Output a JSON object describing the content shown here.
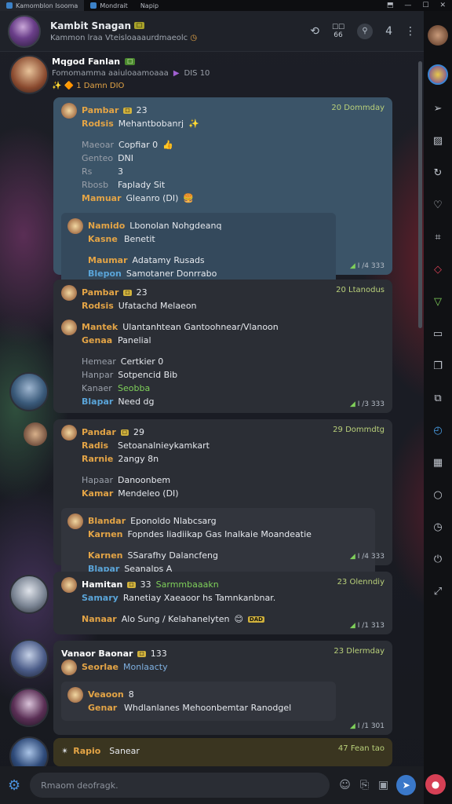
{
  "window": {
    "tabs": [
      "Kamomblon Isooma",
      "Mondrait",
      "Napip"
    ],
    "controls": [
      "⬒",
      "—",
      "☐",
      "✕"
    ]
  },
  "header": {
    "title": "Kambit Snagan",
    "title_tag": "☐",
    "subtitle": "Kammon lraa Vteisloaaaurdmaeolc",
    "chip_top": "☐☐",
    "chip_bottom": "66",
    "count": "4"
  },
  "first_message": {
    "name": "Mqgod Fanlan",
    "tag": "☐",
    "status_line": "Fomomamma aaiuloaamoaaa",
    "status_value": "DIS 10",
    "reactions": "✨ 🔶 1  Damn  DIO"
  },
  "cards": [
    {
      "time": "20 Dommday",
      "header_name": "Pambar",
      "header_tag": "☐",
      "header_num": "23",
      "rows": [
        {
          "label": "Rodsis",
          "value": "Mehantbobanrj"
        },
        {
          "label": "Maeoar",
          "value": "Copfiar 0"
        },
        {
          "label": "Genteo",
          "value": "DNI"
        },
        {
          "label": "Rs",
          "value": "3"
        },
        {
          "label": "Rbosb",
          "value": "Faplady Sit"
        },
        {
          "label": "Mamuar",
          "value": "Gleanro (DI)"
        }
      ],
      "sub_rows": [
        {
          "label": "Namido",
          "value": "Lbonolan Nohgdeanq"
        },
        {
          "label": "Kasne",
          "value": "Benetit"
        },
        {
          "label": "Maumar",
          "value": "Adatamy Rusads"
        },
        {
          "label": "Blepon",
          "value": "Samotaner Donrrabo"
        }
      ],
      "foot": "I /4 333"
    },
    {
      "time": "20 Ltanodus",
      "header_name": "Pambar",
      "header_tag": "☐",
      "header_num": "23",
      "rows": [
        {
          "label": "Rodsis",
          "value": "Ufatachd Melaeon"
        },
        {
          "label": "Mantek",
          "value": "Ulantanhtean Gantoohnear/Vlanoon"
        },
        {
          "label": "Genaa",
          "value": "Panelial"
        },
        {
          "label": "Hemear",
          "value": "Certkier 0"
        },
        {
          "label": "Hanpar",
          "value": "Sotpencid Bib"
        },
        {
          "label": "Kanaer",
          "value": "Seobba"
        },
        {
          "label": "Blapar",
          "value": "Need dg"
        }
      ],
      "foot": "I /3 333"
    },
    {
      "time": "29 Dommdtg",
      "header_name": "Pandar",
      "header_tag": "☐",
      "header_num": "29",
      "rows": [
        {
          "label": "Radis",
          "value": "Setoanalnieykamkart"
        },
        {
          "label": "Rarnie",
          "value": "2angy 8n"
        },
        {
          "label": "Hapaar",
          "value": "Danoonbem"
        },
        {
          "label": "Kamar",
          "value": "Mendeleo (DI)"
        }
      ],
      "sub_rows": [
        {
          "label": "Blandar",
          "value": "Eponoldo Nlabcsarg"
        },
        {
          "label": "Karnen",
          "value": "Fopndes Iiadiikap  Gas Inalkaie  Moandeatie"
        },
        {
          "label": "Karnen",
          "value": "SSarafhy Dalancfeng"
        },
        {
          "label": "Blapar",
          "value": "Seanalps A"
        }
      ],
      "foot": "I /4 333"
    },
    {
      "time": "23 Olenndiy",
      "header_name": "Hamitan",
      "header_tag": "☐",
      "header_num": "33",
      "header_extra": "Sarmmbaaakn",
      "rows": [
        {
          "label": "Samary",
          "value": "Ranetiay Xaeaoor hs Tamnkanbnar."
        },
        {
          "label": "Nanaar",
          "value": "Alo Sung / Kelahanelyten"
        }
      ],
      "extra_badge": "DAD",
      "foot": "I /1 313"
    },
    {
      "time": "23 Dlermday",
      "header_name": "Vanaor Baonar",
      "header_tag": "☐",
      "header_num": "133",
      "rows": [
        {
          "label": "Seorlae",
          "value": "Monlaacty"
        }
      ],
      "sub_rows": [
        {
          "label": "Veaoon",
          "value": "8"
        },
        {
          "label": "Genar",
          "value": "Whdlanlanes Mehoonbemtar  Ranodgel"
        }
      ],
      "foot": "I /1 301"
    },
    {
      "time": "47 Fean tao",
      "header_name": "Rapio",
      "header_extra": "Sanear",
      "rows": []
    }
  ],
  "input": {
    "placeholder": "Rmaom deofragk."
  },
  "rail_icons": [
    "avatar",
    "ring",
    "send",
    "image",
    "refresh",
    "heart",
    "crop",
    "diamond",
    "play",
    "screen",
    "book",
    "copy",
    "timer",
    "grid",
    "circle",
    "clock",
    "power",
    "expand"
  ]
}
